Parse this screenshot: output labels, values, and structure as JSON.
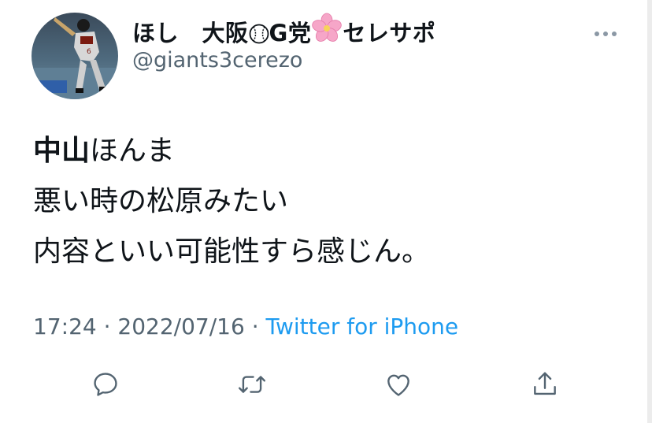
{
  "user": {
    "display_name_part1": "ほし　大阪",
    "display_name_part2": "G党",
    "display_name_part3": "セレサポ",
    "handle": "@giants3cerezo",
    "baseball_emoji": "baseball-icon",
    "flower_emoji": "cherry-blossom-icon"
  },
  "tweet": {
    "mention": "中山",
    "line1_rest": "ほんま",
    "line2": "悪い時の松原みたい",
    "line3": "内容といい可能性すら感じん。"
  },
  "meta": {
    "time": "17:24",
    "separator1": " · ",
    "date": "2022/07/16",
    "separator2": " · ",
    "source": "Twitter for iPhone"
  },
  "actions": [
    "reply-icon",
    "retweet-icon",
    "like-icon",
    "share-icon"
  ],
  "colors": {
    "link": "#1d9bf0",
    "secondary": "#536471",
    "text": "#0f1419"
  }
}
